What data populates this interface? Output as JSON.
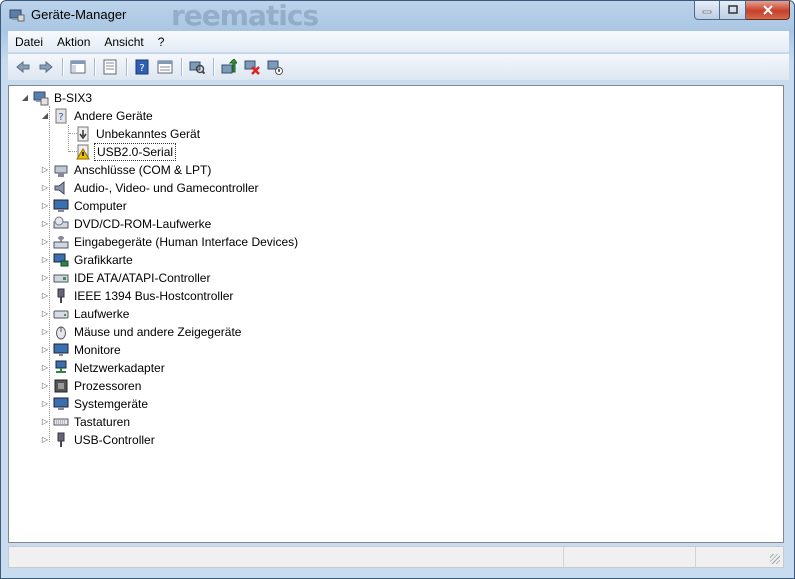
{
  "window": {
    "title": "Geräte-Manager"
  },
  "menu": [
    {
      "label": "Datei"
    },
    {
      "label": "Aktion"
    },
    {
      "label": "Ansicht"
    },
    {
      "label": "?"
    }
  ],
  "tree": {
    "root": "B-SIX3",
    "other_devices": {
      "label": "Andere Geräte",
      "children": [
        "Unbekanntes Gerät",
        "USB2.0-Serial"
      ]
    },
    "categories": [
      "Anschlüsse (COM & LPT)",
      "Audio-, Video- und Gamecontroller",
      "Computer",
      "DVD/CD-ROM-Laufwerke",
      "Eingabegeräte (Human Interface Devices)",
      "Grafikkarte",
      "IDE ATA/ATAPI-Controller",
      "IEEE 1394 Bus-Hostcontroller",
      "Laufwerke",
      "Mäuse und andere Zeigegeräte",
      "Monitore",
      "Netzwerkadapter",
      "Prozessoren",
      "Systemgeräte",
      "Tastaturen",
      "USB-Controller"
    ]
  },
  "colors": {
    "accent": "#3c5a7c",
    "selection_border": "#333333",
    "warning": "#f0c000"
  }
}
